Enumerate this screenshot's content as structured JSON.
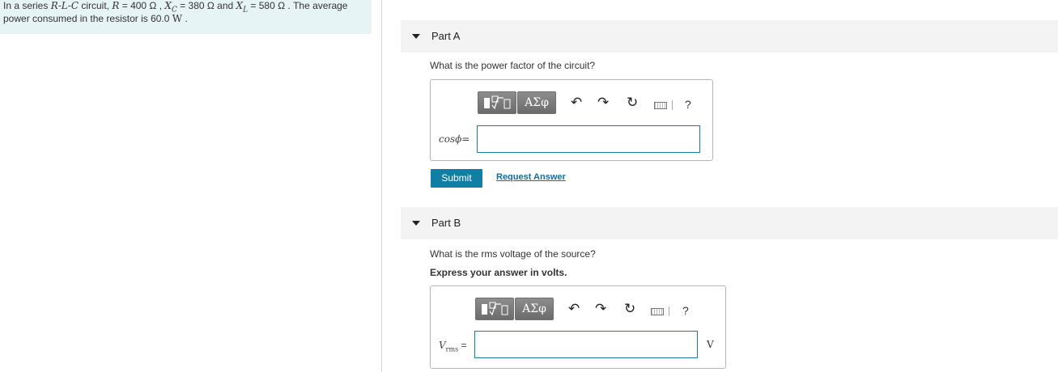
{
  "problem": {
    "line1_prefix": "In a series ",
    "circuit_type": "R-L-C",
    "line1_after_type": " circuit, ",
    "R_symbol": "R",
    "R_value": " = 400 Ω , ",
    "XC_symbol": "X",
    "XC_sub": "C",
    "XC_value": " = 380 Ω and ",
    "XL_symbol": "X",
    "XL_sub": "L",
    "XL_value": " = 580 Ω . The average",
    "line2_text": "power consumed in the resistor is 60.0 ",
    "line2_unit": "W",
    "line2_end": " ."
  },
  "parts": [
    {
      "title": "Part A",
      "question": "What is the power factor of the circuit?",
      "label": "cosϕ=",
      "input_value": "",
      "submit_label": "Submit",
      "request_label": "Request Answer"
    },
    {
      "title": "Part B",
      "question": "What is the rms voltage of the source?",
      "instruction": "Express your answer in volts.",
      "label_var": "V",
      "label_sub": "rms",
      "label_eq": " =",
      "input_value": "",
      "unit": "V"
    }
  ],
  "toolbar": {
    "symbols_label": "ΑΣφ",
    "undo_glyph": "↶",
    "redo_glyph": "↷",
    "reset_glyph": "↻",
    "help_glyph": "?"
  },
  "colors": {
    "problem_bg": "#e6f4f5",
    "accent": "#127ea3",
    "input_border": "#1a7a9e"
  }
}
